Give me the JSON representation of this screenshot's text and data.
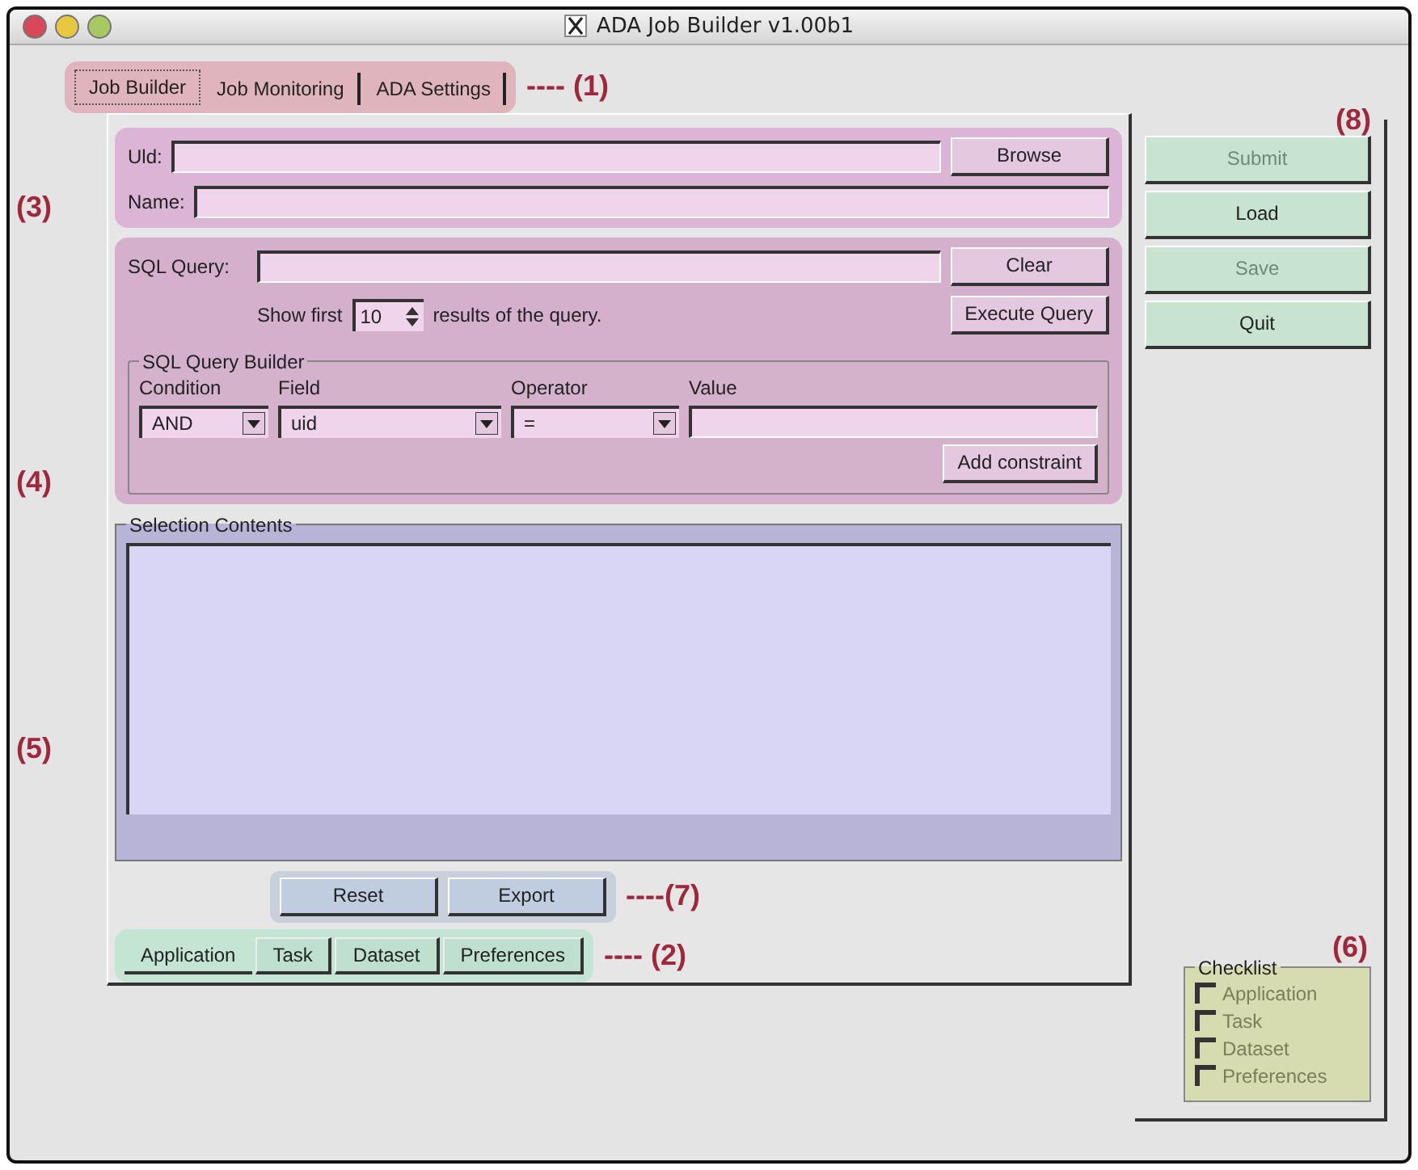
{
  "window": {
    "title": "ADA Job Builder v1.00b1"
  },
  "top_tabs": [
    {
      "label": "Job Builder",
      "selected": true
    },
    {
      "label": "Job Monitoring",
      "selected": false
    },
    {
      "label": "ADA Settings",
      "selected": false
    }
  ],
  "job": {
    "uid_label": "Uld:",
    "browse": "Browse",
    "name_label": "Name:"
  },
  "sql": {
    "label": "SQL Query:",
    "clear": "Clear",
    "show_first": "Show first",
    "count": "10",
    "suffix": "results of the query.",
    "execute": "Execute Query"
  },
  "builder": {
    "title": "SQL Query Builder",
    "columns": [
      "Condition",
      "Field",
      "Operator",
      "Value"
    ],
    "condition": "AND",
    "field": "uid",
    "operator": "=",
    "add": "Add constraint"
  },
  "selection": {
    "title": "Selection Contents"
  },
  "actions": [
    "Reset",
    "Export"
  ],
  "bottom_tabs": [
    {
      "label": "Application",
      "selected": true
    },
    {
      "label": "Task",
      "selected": false
    },
    {
      "label": "Dataset",
      "selected": false
    },
    {
      "label": "Preferences",
      "selected": false
    }
  ],
  "side_buttons": [
    {
      "label": "Submit",
      "disabled": true
    },
    {
      "label": "Load",
      "disabled": false
    },
    {
      "label": "Save",
      "disabled": true
    },
    {
      "label": "Quit",
      "disabled": false
    }
  ],
  "checklist": {
    "title": "Checklist",
    "items": [
      {
        "label": "Application",
        "checked": false,
        "disabled": true
      },
      {
        "label": "Task",
        "checked": false,
        "disabled": true
      },
      {
        "label": "Dataset",
        "checked": false,
        "disabled": true
      },
      {
        "label": "Preferences",
        "checked": false,
        "disabled": true
      }
    ]
  },
  "annotations": [
    "---- (1)",
    "---- (2)",
    "(3)",
    "(4)",
    "(5)",
    "(6)",
    "----(7)",
    "(8)"
  ]
}
